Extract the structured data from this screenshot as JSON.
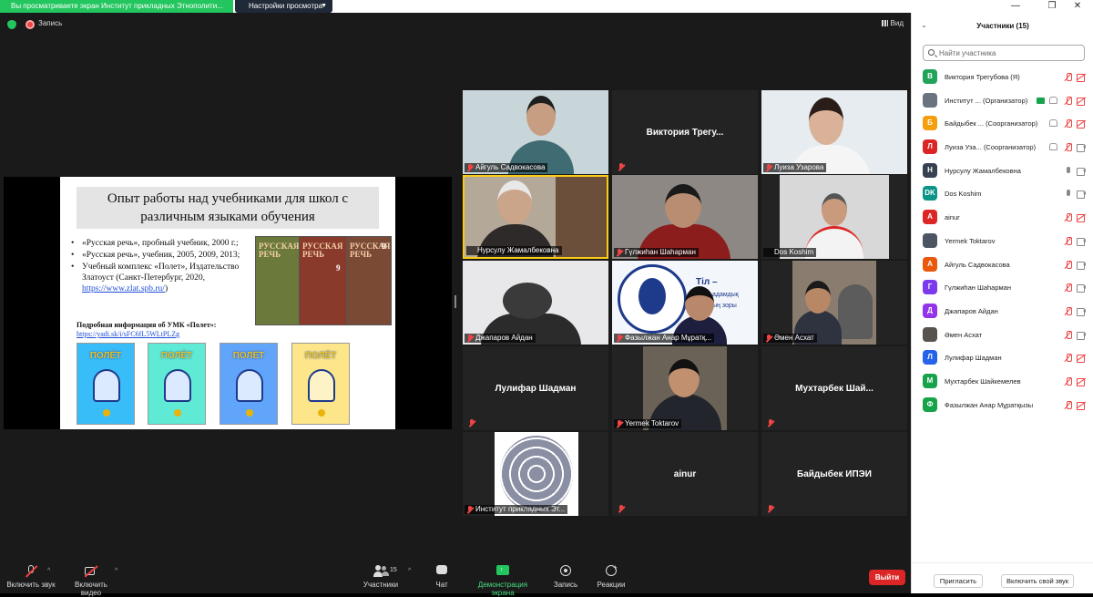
{
  "window": {
    "share_banner": "Вы просматриваете экран Институт прикладных Этнополити...",
    "view_options": "Настройки просмотра",
    "view_button": "Вид"
  },
  "meeting": {
    "recording_label": "Запись"
  },
  "slide": {
    "title": "Опыт работы над учебниками для школ с различным языками обучения",
    "bullet_1": "«Русская речь», пробный учебник, 2000 г.;",
    "bullet_2": "«Русская речь», учебник, 2005, 2009, 2013;",
    "bullet_3_pre": "Учебный комплекс «Полет», Издательство Златоуст (Санкт-Петербург, 2020, ",
    "bullet_3_link": "https://www.zlat.spb.ru/",
    "bullet_3_post": ")",
    "info_title": "Подробная информация об УМК «Полет»:",
    "info_link": "https://yadi.sk/i/sFC6fL5WLtPLZg",
    "book_title": "РУССКАЯ РЕЧЬ",
    "book_number": "9",
    "cover_title": "ПОЛЁТ"
  },
  "tiles": [
    {
      "name": "Айгуль Садвокасова"
    },
    {
      "name": "Виктория Трегу..."
    },
    {
      "name": "Луиза Узарова"
    },
    {
      "name": "Нурсулу Жамалбековна"
    },
    {
      "name": "Гүлжиһан Шаһарман"
    },
    {
      "name": "Dos Koshim"
    },
    {
      "name": "Джапаров Айдан"
    },
    {
      "name": "Фазылжан Анар Мұратқ..."
    },
    {
      "name": "Әмен Асхат"
    },
    {
      "name": "Лулифар Шадман"
    },
    {
      "name": "Yermek Toktarov"
    },
    {
      "name": "Мухтарбек Шай..."
    },
    {
      "name": "Институт прикладных Эт..."
    },
    {
      "name": "ainur"
    },
    {
      "name": "Байдыбек ИПЭИ"
    }
  ],
  "tile_text": {
    "fazylzhan_overlay_1": "Тіл –",
    "fazylzhan_overlay_2": "адамдық",
    "fazylzhan_overlay_3": "ың зоры"
  },
  "toolbar": {
    "mute_label": "Включить звук",
    "video_label": "Включить видео",
    "participants_label": "Участники",
    "participants_count": "15",
    "chat_label": "Чат",
    "share_label": "Демонстрация экрана",
    "record_label": "Запись",
    "reactions_label": "Реакции",
    "leave_label": "Выйти"
  },
  "panel": {
    "title": "Участники (15)",
    "search_placeholder": "Найти участника",
    "invite_label": "Пригласить",
    "unmute_me_label": "Включить свой звук",
    "participants": [
      {
        "initial": "В",
        "name": "Виктория Трегубова",
        "role": "(Я)",
        "color": "#22a35a",
        "mic": "off",
        "cam": "off"
      },
      {
        "initial": "",
        "name": "Институт ...",
        "role": "(Организатор)",
        "color": "#6b7280",
        "mic": "off",
        "cam": "off"
      },
      {
        "initial": "Б",
        "name": "Байдыбек ...",
        "role": "(Соорганизатор)",
        "color": "#f59e0b",
        "mic": "off",
        "cam": "off"
      },
      {
        "initial": "Л",
        "name": "Луиза Уза...",
        "role": "(Соорганизатор)",
        "color": "#dc2626",
        "mic": "off",
        "cam": "on"
      },
      {
        "initial": "Н",
        "name": "Нурсулу Жамалбековна",
        "role": "",
        "color": "#374151",
        "mic": "on",
        "cam": "on"
      },
      {
        "initial": "DK",
        "name": "Dos Koshim",
        "role": "",
        "color": "#0d9488",
        "mic": "on",
        "cam": "on"
      },
      {
        "initial": "A",
        "name": "ainur",
        "role": "",
        "color": "#dc2626",
        "mic": "off",
        "cam": "off"
      },
      {
        "initial": "",
        "name": "Yermek Toktarov",
        "role": "",
        "color": "#4b5563",
        "mic": "off",
        "cam": "on"
      },
      {
        "initial": "А",
        "name": "Айгуль Садвокасова",
        "role": "",
        "color": "#ea580c",
        "mic": "off",
        "cam": "on"
      },
      {
        "initial": "Г",
        "name": "Гүлжиһан Шаһарман",
        "role": "",
        "color": "#7c3aed",
        "mic": "off",
        "cam": "on"
      },
      {
        "initial": "Д",
        "name": "Джапаров Айдан",
        "role": "",
        "color": "#9333ea",
        "mic": "off",
        "cam": "on"
      },
      {
        "initial": "",
        "name": "Әмен Асхат",
        "role": "",
        "color": "#57534e",
        "mic": "off",
        "cam": "on"
      },
      {
        "initial": "Л",
        "name": "Лулифар Шадман",
        "role": "",
        "color": "#2563eb",
        "mic": "off",
        "cam": "off"
      },
      {
        "initial": "М",
        "name": "Мухтарбек Шайкемелев",
        "role": "",
        "color": "#16a34a",
        "mic": "off",
        "cam": "off"
      },
      {
        "initial": "Ф",
        "name": "Фазылжан Анар Мұратқызы",
        "role": "",
        "color": "#16a34a",
        "mic": "off",
        "cam": "off"
      }
    ]
  }
}
